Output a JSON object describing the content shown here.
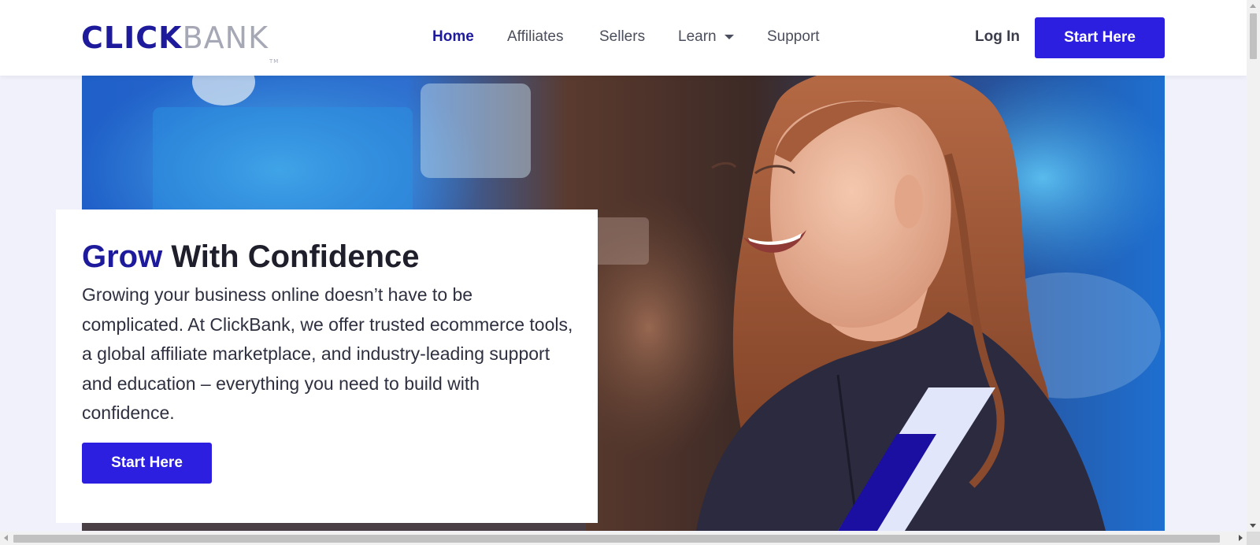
{
  "header": {
    "logo": {
      "part1": "CLICK",
      "part2": "BANK",
      "tm": "TM"
    },
    "nav": [
      {
        "label": "Home",
        "active": true
      },
      {
        "label": "Affiliates",
        "active": false
      },
      {
        "label": "Sellers",
        "active": false
      },
      {
        "label": "Learn",
        "active": false,
        "has_dropdown": true
      },
      {
        "label": "Support",
        "active": false
      }
    ],
    "login_label": "Log In",
    "start_label": "Start Here"
  },
  "hero": {
    "title_highlight": "Grow",
    "title_rest": " With Confidence",
    "description": "Growing your business online doesn’t have to be complicated. At ClickBank, we offer trusted ecommerce tools, a global affiliate marketplace, and industry-leading support and education – everything you need to build with confidence.",
    "cta_label": "Start Here",
    "photo": "smiling-woman-photo"
  },
  "colors": {
    "brand_dark": "#1d1a9c",
    "accent": "#2d1fe0",
    "logo_gray": "#a6a8b6",
    "page_bg": "#f0f1fb"
  }
}
